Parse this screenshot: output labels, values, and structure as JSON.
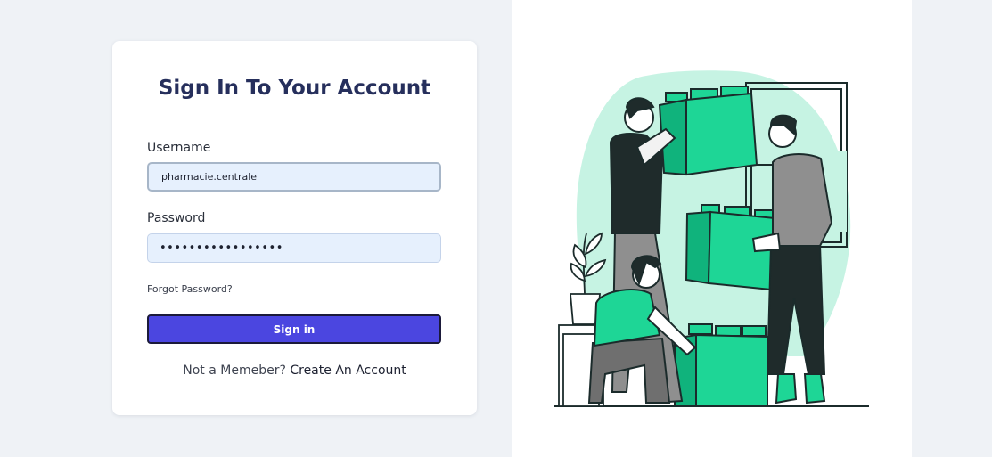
{
  "login": {
    "title": "Sign In To Your Account",
    "username_label": "Username",
    "username_value": "pharmacie.centrale",
    "password_label": "Password",
    "password_masked": "•••••••••••••••••",
    "forgot_password": "Forgot Password?",
    "signin_button": "Sign in",
    "not_member": "Not a Memeber?",
    "create_account": "Create An Account"
  },
  "colors": {
    "primary_button": "#4b46e0",
    "title": "#262f5c",
    "input_bg": "#e6f0fd",
    "illustration_accent": "#1ed696"
  }
}
